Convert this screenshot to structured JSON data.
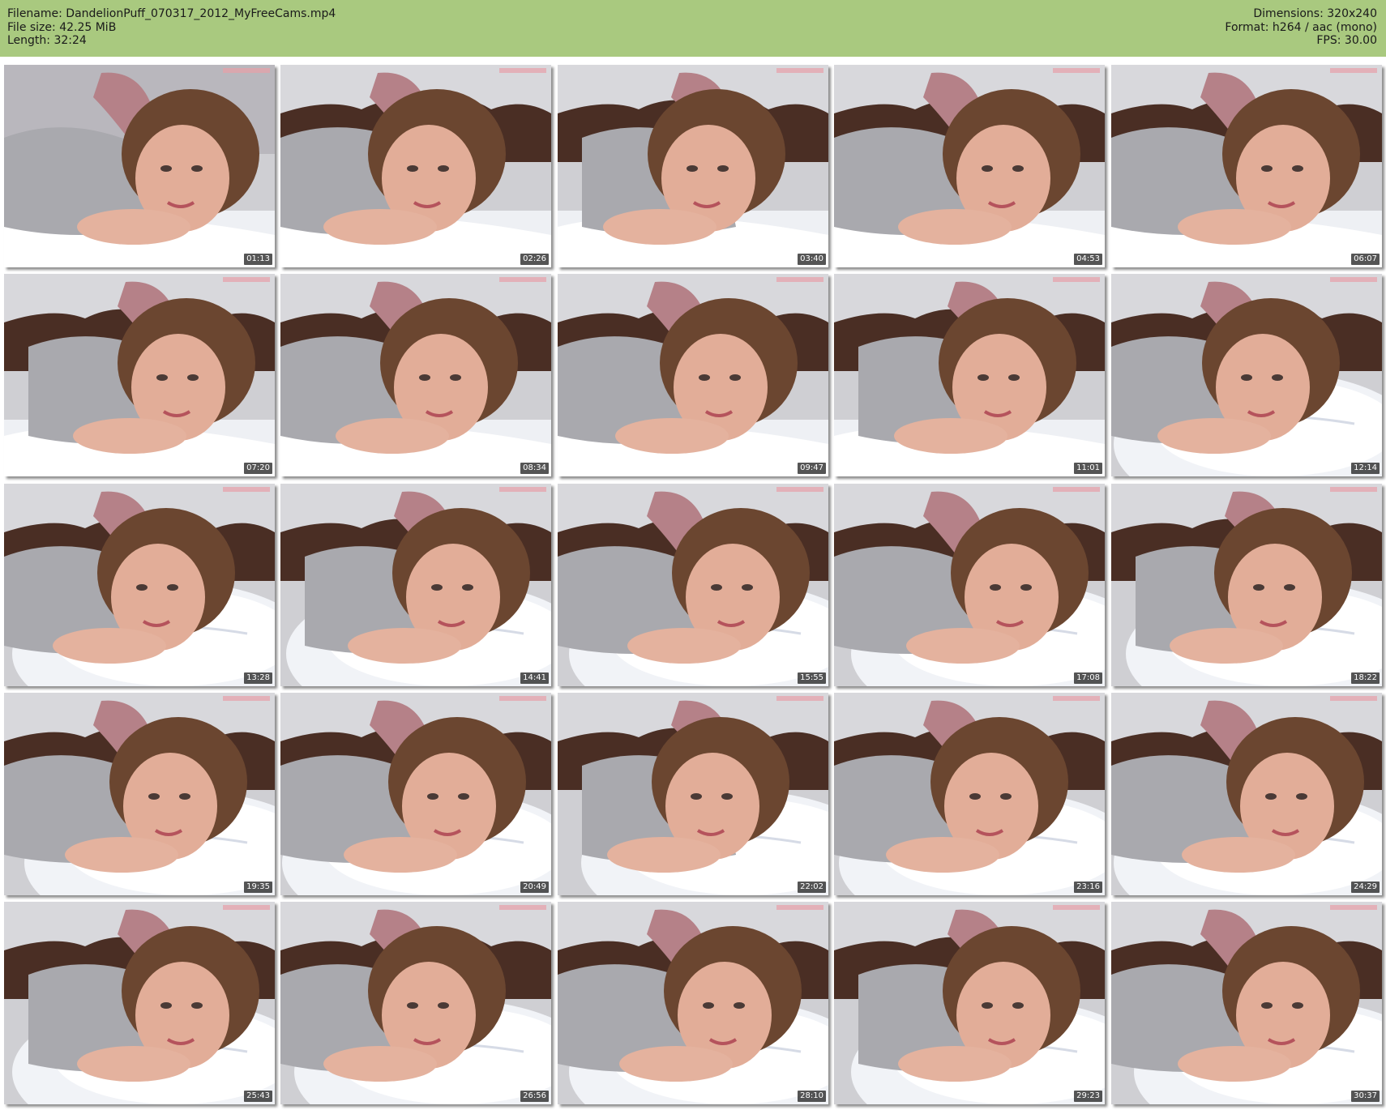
{
  "meta": {
    "filename": "Filename: DandelionPuff_070317_2012_MyFreeCams.mp4",
    "filesize": "File size: 42.25 MiB",
    "length": "Length: 32:24",
    "dimensions": "Dimensions: 320x240",
    "format": "Format: h264 / aac (mono)",
    "fps": "FPS: 30.00"
  },
  "colors": {
    "header_bg": "#a9c97f",
    "page_bg": "#ffffff"
  },
  "thumbnails": [
    {
      "time": "01:13",
      "variant": "wall-grey"
    },
    {
      "time": "02:26",
      "variant": "headboard"
    },
    {
      "time": "03:40",
      "variant": "headboard"
    },
    {
      "time": "04:53",
      "variant": "headboard"
    },
    {
      "time": "06:07",
      "variant": "headboard"
    },
    {
      "time": "07:20",
      "variant": "headboard"
    },
    {
      "time": "08:34",
      "variant": "headboard"
    },
    {
      "time": "09:47",
      "variant": "headboard"
    },
    {
      "time": "11:01",
      "variant": "headboard"
    },
    {
      "time": "12:14",
      "variant": "pillow"
    },
    {
      "time": "13:28",
      "variant": "pillow"
    },
    {
      "time": "14:41",
      "variant": "pillow"
    },
    {
      "time": "15:55",
      "variant": "pillow"
    },
    {
      "time": "17:08",
      "variant": "pillow"
    },
    {
      "time": "18:22",
      "variant": "pillow"
    },
    {
      "time": "19:35",
      "variant": "pillow"
    },
    {
      "time": "20:49",
      "variant": "pillow"
    },
    {
      "time": "22:02",
      "variant": "pillow"
    },
    {
      "time": "23:16",
      "variant": "pillow"
    },
    {
      "time": "24:29",
      "variant": "pillow"
    },
    {
      "time": "25:43",
      "variant": "pillow"
    },
    {
      "time": "26:56",
      "variant": "pillow"
    },
    {
      "time": "28:10",
      "variant": "pillow"
    },
    {
      "time": "29:23",
      "variant": "pillow"
    },
    {
      "time": "30:37",
      "variant": "pillow"
    }
  ]
}
